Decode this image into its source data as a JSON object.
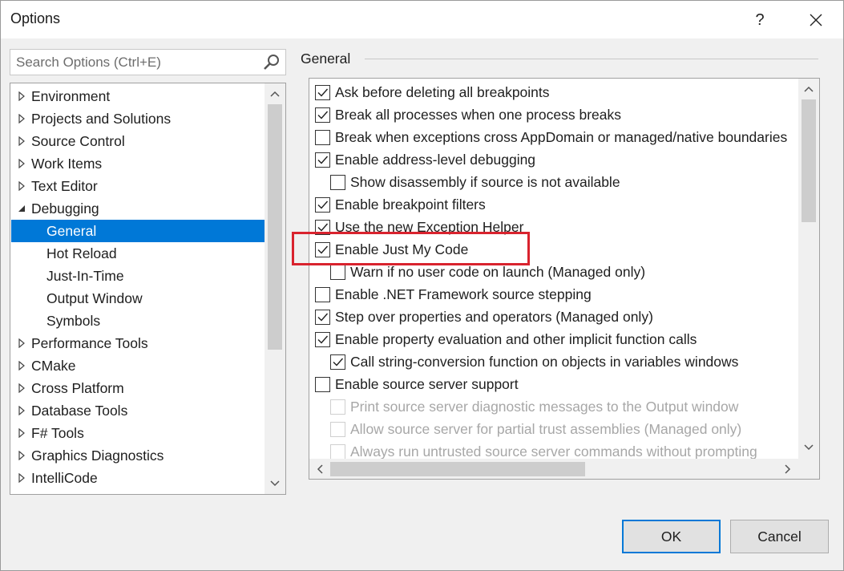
{
  "window": {
    "title": "Options",
    "help_label": "?",
    "close_label": "✕"
  },
  "search": {
    "placeholder": "Search Options (Ctrl+E)",
    "value": ""
  },
  "tree": {
    "items": [
      {
        "label": "Environment",
        "level": 0,
        "expanded": false,
        "selected": false
      },
      {
        "label": "Projects and Solutions",
        "level": 0,
        "expanded": false,
        "selected": false
      },
      {
        "label": "Source Control",
        "level": 0,
        "expanded": false,
        "selected": false
      },
      {
        "label": "Work Items",
        "level": 0,
        "expanded": false,
        "selected": false
      },
      {
        "label": "Text Editor",
        "level": 0,
        "expanded": false,
        "selected": false
      },
      {
        "label": "Debugging",
        "level": 0,
        "expanded": true,
        "selected": false
      },
      {
        "label": "General",
        "level": 1,
        "selected": true
      },
      {
        "label": "Hot Reload",
        "level": 1,
        "selected": false
      },
      {
        "label": "Just-In-Time",
        "level": 1,
        "selected": false
      },
      {
        "label": "Output Window",
        "level": 1,
        "selected": false
      },
      {
        "label": "Symbols",
        "level": 1,
        "selected": false
      },
      {
        "label": "Performance Tools",
        "level": 0,
        "expanded": false,
        "selected": false
      },
      {
        "label": "CMake",
        "level": 0,
        "expanded": false,
        "selected": false
      },
      {
        "label": "Cross Platform",
        "level": 0,
        "expanded": false,
        "selected": false
      },
      {
        "label": "Database Tools",
        "level": 0,
        "expanded": false,
        "selected": false
      },
      {
        "label": "F# Tools",
        "level": 0,
        "expanded": false,
        "selected": false
      },
      {
        "label": "Graphics Diagnostics",
        "level": 0,
        "expanded": false,
        "selected": false
      },
      {
        "label": "IntelliCode",
        "level": 0,
        "expanded": false,
        "selected": false
      }
    ]
  },
  "group": {
    "label": "General"
  },
  "options": [
    {
      "label": "Ask before deleting all breakpoints",
      "checked": true,
      "indent": 0,
      "disabled": false
    },
    {
      "label": "Break all processes when one process breaks",
      "checked": true,
      "indent": 0,
      "disabled": false
    },
    {
      "label": "Break when exceptions cross AppDomain or managed/native boundaries",
      "checked": false,
      "indent": 0,
      "disabled": false
    },
    {
      "label": "Enable address-level debugging",
      "checked": true,
      "indent": 0,
      "disabled": false
    },
    {
      "label": "Show disassembly if source is not available",
      "checked": false,
      "indent": 1,
      "disabled": false
    },
    {
      "label": "Enable breakpoint filters",
      "checked": true,
      "indent": 0,
      "disabled": false
    },
    {
      "label": "Use the new Exception Helper",
      "checked": true,
      "indent": 0,
      "disabled": false
    },
    {
      "label": "Enable Just My Code",
      "checked": true,
      "indent": 0,
      "disabled": false,
      "highlighted": true
    },
    {
      "label": "Warn if no user code on launch (Managed only)",
      "checked": false,
      "indent": 1,
      "disabled": false
    },
    {
      "label": "Enable .NET Framework source stepping",
      "checked": false,
      "indent": 0,
      "disabled": false
    },
    {
      "label": "Step over properties and operators (Managed only)",
      "checked": true,
      "indent": 0,
      "disabled": false
    },
    {
      "label": "Enable property evaluation and other implicit function calls",
      "checked": true,
      "indent": 0,
      "disabled": false
    },
    {
      "label": "Call string-conversion function on objects in variables windows",
      "checked": true,
      "indent": 1,
      "disabled": false
    },
    {
      "label": "Enable source server support",
      "checked": false,
      "indent": 0,
      "disabled": false
    },
    {
      "label": "Print source server diagnostic messages to the Output window",
      "checked": false,
      "indent": 1,
      "disabled": true
    },
    {
      "label": "Allow source server for partial trust assemblies (Managed only)",
      "checked": false,
      "indent": 1,
      "disabled": true
    },
    {
      "label": "Always run untrusted source server commands without prompting",
      "checked": false,
      "indent": 1,
      "disabled": true
    }
  ],
  "buttons": {
    "ok": "OK",
    "cancel": "Cancel"
  },
  "colors": {
    "selection": "#0078d7",
    "highlight_box": "#d9232e",
    "dialog_bg": "#f0f0f0"
  }
}
